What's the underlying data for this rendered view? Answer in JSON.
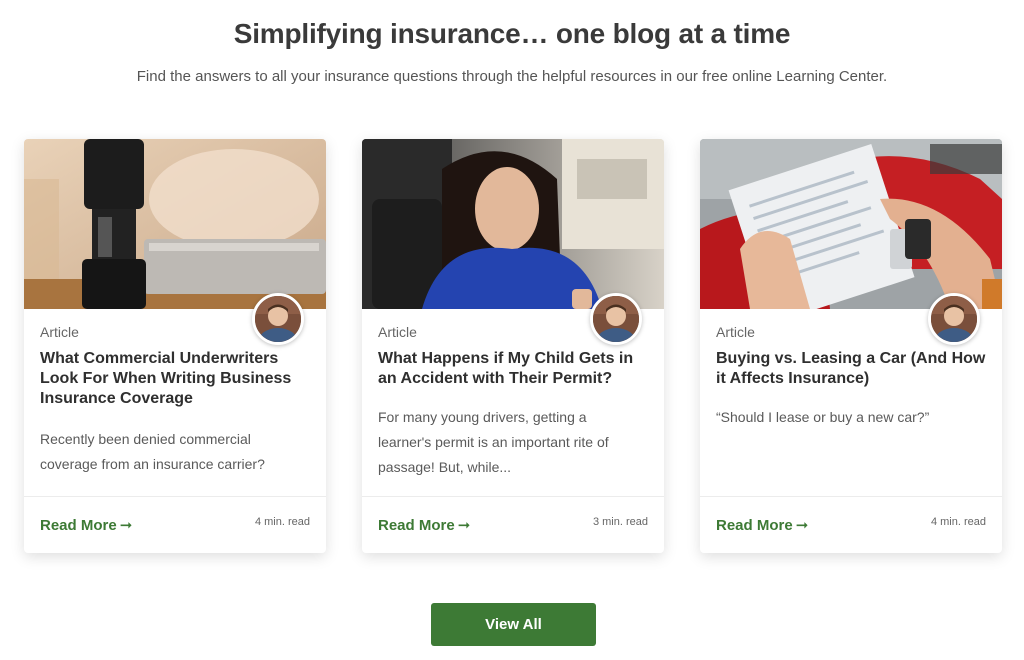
{
  "header": {
    "title": "Simplifying insurance… one blog at a time",
    "subtitle": "Find the answers to all your insurance questions through the helpful resources in our free online Learning Center."
  },
  "cards": [
    {
      "type": "Article",
      "title": "What Commercial Underwriters Look For When Writing Business Insurance Coverage",
      "excerpt": "Recently been denied commercial coverage from an insurance carrier?",
      "read_more": "Read More",
      "read_time": "4 min. read"
    },
    {
      "type": "Article",
      "title": "What Happens if My Child Gets in an Accident with Their Permit?",
      "excerpt": "For many young drivers, getting a learner's permit is an important rite of passage! But, while...",
      "read_more": "Read More",
      "read_time": "3 min. read"
    },
    {
      "type": "Article",
      "title": "Buying vs. Leasing a Car (And How it Affects Insurance)",
      "excerpt": "“Should I lease or buy a new car?”",
      "read_more": "Read More",
      "read_time": "4 min. read"
    }
  ],
  "view_all_label": "View All",
  "icons": {
    "arrow": "arrow-right-icon",
    "avatar": "author-avatar"
  },
  "colors": {
    "accent_green": "#3d7a35",
    "title_text": "#3a3a3a"
  }
}
